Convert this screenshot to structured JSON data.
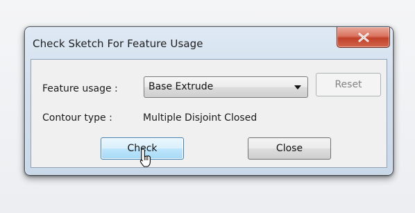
{
  "dialog": {
    "title": "Check Sketch For Feature Usage",
    "close_icon": "close-x-icon"
  },
  "form": {
    "feature_usage_label": "Feature usage :",
    "feature_usage_value": "Base Extrude",
    "reset_label": "Reset",
    "contour_type_label": "Contour type :",
    "contour_type_value": "Multiple Disjoint Closed"
  },
  "buttons": {
    "check_label": "Check",
    "close_label": "Close"
  },
  "cursor": {
    "icon": "hand-pointer-icon"
  },
  "colors": {
    "close_button": "#c9523b",
    "focused_button_border": "#3c7fb1",
    "disabled_text": "#838383"
  }
}
